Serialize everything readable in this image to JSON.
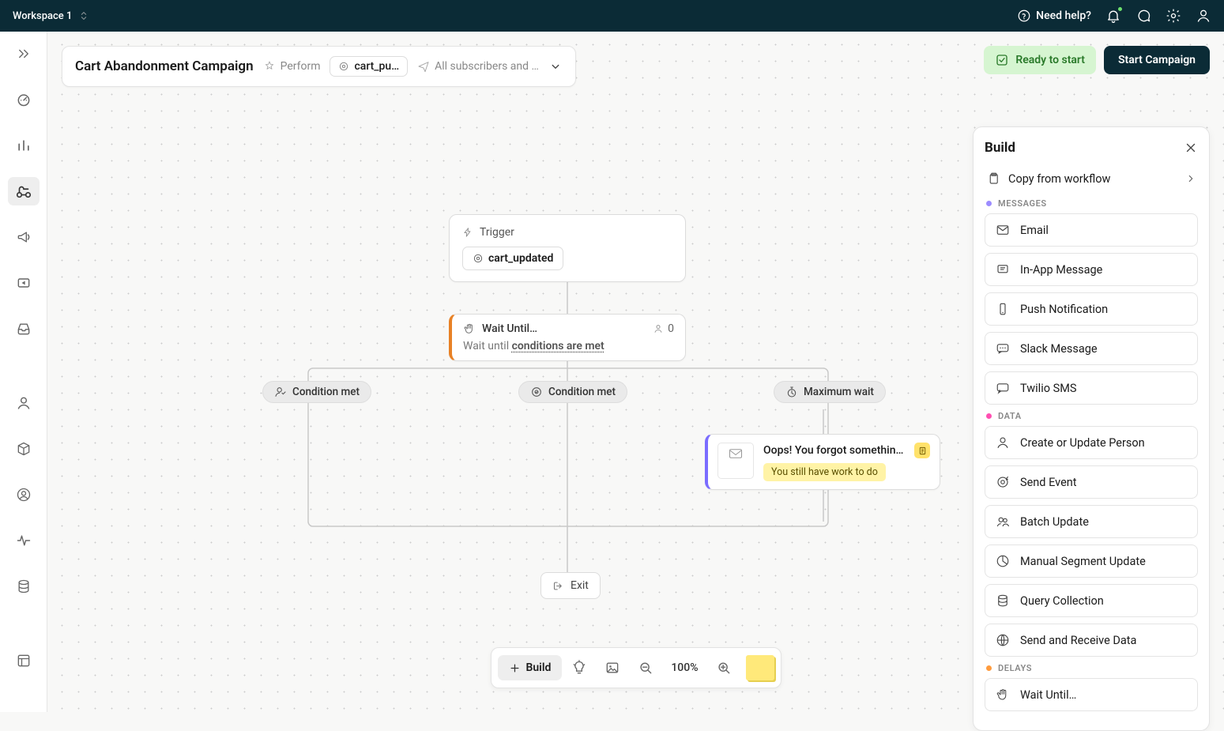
{
  "topbar": {
    "workspace": "Workspace 1",
    "need_help": "Need help?"
  },
  "campaign_header": {
    "title": "Cart Abandonment Campaign",
    "perform": "Perform",
    "trigger_chip": "cart_pu…",
    "audience": "All subscribers and …"
  },
  "top_right": {
    "ready": "Ready to start",
    "start": "Start Campaign"
  },
  "workflow": {
    "trigger": {
      "label": "Trigger",
      "event": "cart_updated"
    },
    "wait": {
      "title": "Wait Until…",
      "count": "0",
      "desc_prefix": "Wait until ",
      "desc_link": "conditions are met"
    },
    "branches": {
      "b1": "Condition met",
      "b2": "Condition met",
      "b3": "Maximum wait"
    },
    "msg": {
      "title": "Oops! You forgot somethin…",
      "sub": "You still have work to do"
    },
    "exit": "Exit"
  },
  "bottom_toolbar": {
    "build": "Build",
    "zoom": "100%"
  },
  "build_panel": {
    "title": "Build",
    "copy": "Copy from workflow",
    "sections": {
      "messages": {
        "label": "MESSAGES",
        "color": "#9c8cff"
      },
      "data": {
        "label": "DATA",
        "color": "#ff4fb2"
      },
      "delays": {
        "label": "DELAYS",
        "color": "#ff9b3d"
      }
    },
    "messages": [
      "Email",
      "In-App Message",
      "Push Notification",
      "Slack Message",
      "Twilio SMS"
    ],
    "data": [
      "Create or Update Person",
      "Send Event",
      "Batch Update",
      "Manual Segment Update",
      "Query Collection",
      "Send and Receive Data"
    ],
    "delays": [
      "Wait Until…"
    ]
  }
}
